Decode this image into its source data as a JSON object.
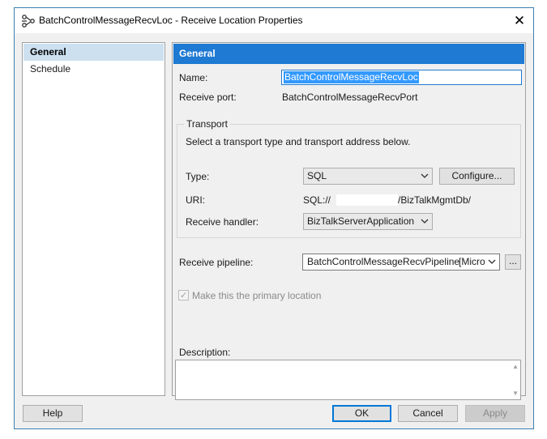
{
  "window": {
    "title": "BatchControlMessageRecvLoc - Receive Location Properties",
    "close_symbol": "✕",
    "icon": "receive-location-icon"
  },
  "nav": {
    "items": [
      {
        "label": "General",
        "selected": true
      },
      {
        "label": "Schedule",
        "selected": false
      }
    ]
  },
  "general": {
    "header": "General",
    "name_label": "Name:",
    "name_value": "BatchControlMessageRecvLoc",
    "port_label": "Receive port:",
    "port_value": "BatchControlMessageRecvPort",
    "transport": {
      "title": "Transport",
      "instructions": "Select a transport type and transport address below.",
      "type_label": "Type:",
      "type_value": "SQL",
      "configure_label": "Configure...",
      "uri_label": "URI:",
      "uri_prefix": "SQL://",
      "uri_suffix": "/BizTalkMgmtDb/",
      "handler_label": "Receive handler:",
      "handler_value": "BizTalkServerApplication"
    },
    "pipeline_label": "Receive pipeline:",
    "pipeline_value": "BatchControlMessageRecvPipeline",
    "pipeline_assembly": "[Micros",
    "browse_label": "...",
    "primary_label": "Make this the primary location",
    "primary_checked": true,
    "description_label": "Description:",
    "description_value": ""
  },
  "footer": {
    "help": "Help",
    "ok": "OK",
    "cancel": "Cancel",
    "apply": "Apply"
  },
  "colors": {
    "accent": "#1e7ad2",
    "selection": "#cce0f0",
    "window_border": "#3c7fb1"
  }
}
